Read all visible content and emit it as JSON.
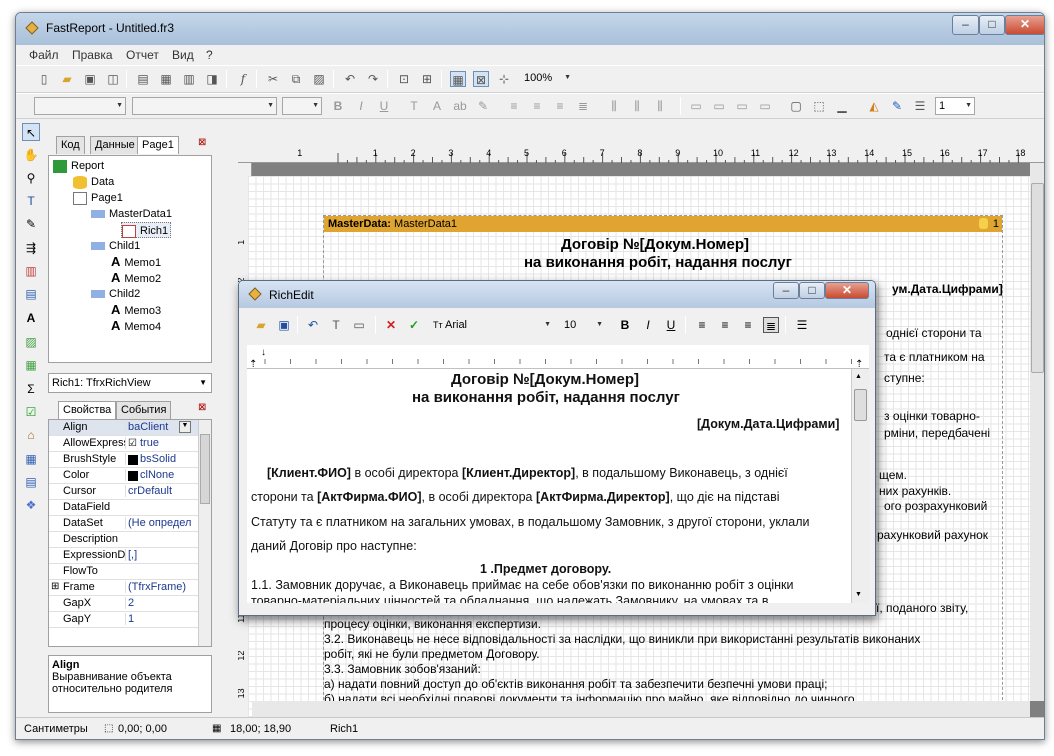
{
  "app": {
    "title": "FastReport - Untitled.fr3",
    "menus": [
      "Файл",
      "Правка",
      "Отчет",
      "Вид",
      "?"
    ],
    "zoom": "100%",
    "line_width": "1"
  },
  "tabs": [
    "Код",
    "Данные",
    "Page1"
  ],
  "tree": [
    "Report",
    "Data",
    "Page1",
    "MasterData1",
    "Rich1",
    "Child1",
    "Memo1",
    "Memo2",
    "Child2",
    "Memo3",
    "Memo4"
  ],
  "object_combo": "Rich1: TfrxRichView",
  "prop_tabs": [
    "Свойства",
    "События"
  ],
  "props": [
    {
      "n": "Align",
      "v": "baClient"
    },
    {
      "n": "AllowExpress",
      "v": "true"
    },
    {
      "n": "BrushStyle",
      "v": "bsSolid"
    },
    {
      "n": "Color",
      "v": "clNone"
    },
    {
      "n": "Cursor",
      "v": "crDefault"
    },
    {
      "n": "DataField",
      "v": ""
    },
    {
      "n": "DataSet",
      "v": "(Не определ"
    },
    {
      "n": "Description",
      "v": ""
    },
    {
      "n": "ExpressionDe",
      "v": "[,]"
    },
    {
      "n": "FlowTo",
      "v": ""
    },
    {
      "n": "Frame",
      "v": "(TfrxFrame)"
    },
    {
      "n": "GapX",
      "v": "2"
    },
    {
      "n": "GapY",
      "v": "1"
    }
  ],
  "help": {
    "title": "Align",
    "text": "Выравнивание объекта относительно родителя"
  },
  "ruler_numbers": [
    "1",
    "1",
    "2",
    "3",
    "4",
    "5",
    "6",
    "7",
    "8",
    "9",
    "10",
    "11",
    "12",
    "13",
    "14",
    "15",
    "16",
    "17",
    "18"
  ],
  "band": {
    "label": "MasterData:",
    "name": "MasterData1",
    "count": "1"
  },
  "page_text": {
    "h1": "Договір №[Докум.Номер]",
    "h2": "на виконання робіт, надання послуг",
    "date": "ум.Дата.Цифрами]",
    "r1": "однієї сторони та",
    "r2": "та є платником на",
    "r3": "ступне:",
    "r4": "з оцінки товарно-",
    "r5": "рміни, передбачені",
    "r6": "щем.",
    "r7": "них рахунків.",
    "r8": "ого розрахунковий",
    "r9": "рахунковий рахунок",
    "r10": "ї, поданого звіту,",
    "b1": "процесу оцінки, виконання експертизи.",
    "b2": "3.2. Виконавець не несе відповідальності за наслідки, що виникли при використанні результатів виконаних",
    "b3": "робіт, які не були предметом Договору.",
    "b4": "3.3. Замовник зобов'язаний:",
    "b5": "а) надати повний доступ до об'єктів виконання робіт та забезпечити безпечні умови праці;",
    "b6": "б) надати всі необхідні правові документи та інформацію про майно, яке відповідно до чинного"
  },
  "status": {
    "units": "Сантиметры",
    "pos": "0,00; 0,00",
    "size": "18,00; 18,90",
    "name": "Rich1"
  },
  "richedit": {
    "title": "RichEdit",
    "font": "Arial",
    "size": "10",
    "h1": "Договір №[Докум.Номер]",
    "h2": "на виконання робіт, надання послуг",
    "date": "[Докум.Дата.Цифрами]",
    "p1a": "[Клиент.ФИО]",
    "p1b": "в особі директора",
    "p1c": "[Клиент.Директор]",
    "p1d": ", в подальшому Виконавець, з однієї",
    "p2a": "сторони та",
    "p2b": "[АктФирма.ФИО]",
    "p2c": ", в особі директора",
    "p2d": "[АктФирма.Директор]",
    "p2e": ", що діє на підставі",
    "p3": "Статуту та є платником на загальних умовах, в подальшому Замовник, з другої сторони, уклали",
    "p4": "даний Договір про наступне:",
    "sec": "1 .Предмет договору.",
    "l1": "1.1.  Замовник доручає, а Виконавець приймає на себе обов'язки по виконанню робіт з оцінки",
    "l2": "товарно-матеріальних цінностей та обладнання,  що належать Замовнику,  на умовах та в"
  }
}
